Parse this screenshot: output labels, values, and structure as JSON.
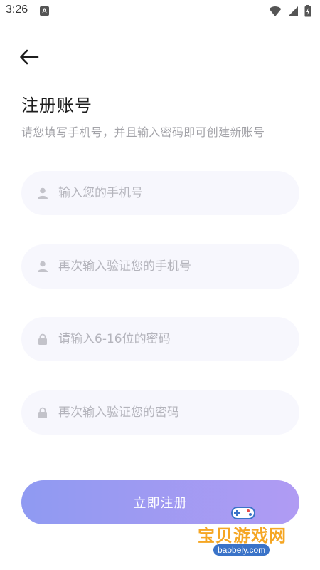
{
  "status_bar": {
    "time": "3:26",
    "notification_badge": "A",
    "icons": [
      "wifi-icon",
      "signal-icon",
      "battery-icon"
    ]
  },
  "header": {
    "back_icon": "arrow-left-icon",
    "title": "注册账号",
    "subtitle": "请您填写手机号，并且输入密码即可创建新账号"
  },
  "form": {
    "phone": {
      "placeholder": "输入您的手机号",
      "value": "",
      "icon": "user-icon"
    },
    "phone_confirm": {
      "placeholder": "再次输入验证您的手机号",
      "value": "",
      "icon": "user-icon"
    },
    "password": {
      "placeholder": "请输入6-16位的密码",
      "value": "",
      "icon": "lock-icon"
    },
    "password_confirm": {
      "placeholder": "再次输入验证您的密码",
      "value": "",
      "icon": "lock-icon"
    }
  },
  "submit": {
    "label": "立即注册"
  },
  "watermark": {
    "text": "宝贝游戏网",
    "url": "baobeiy.com"
  },
  "colors": {
    "field_bg": "#f7f7fd",
    "placeholder": "#b4b4bc",
    "button_gradient_start": "#8f9af2",
    "button_gradient_end": "#b09bf3",
    "subtitle": "#a3a3a8"
  }
}
